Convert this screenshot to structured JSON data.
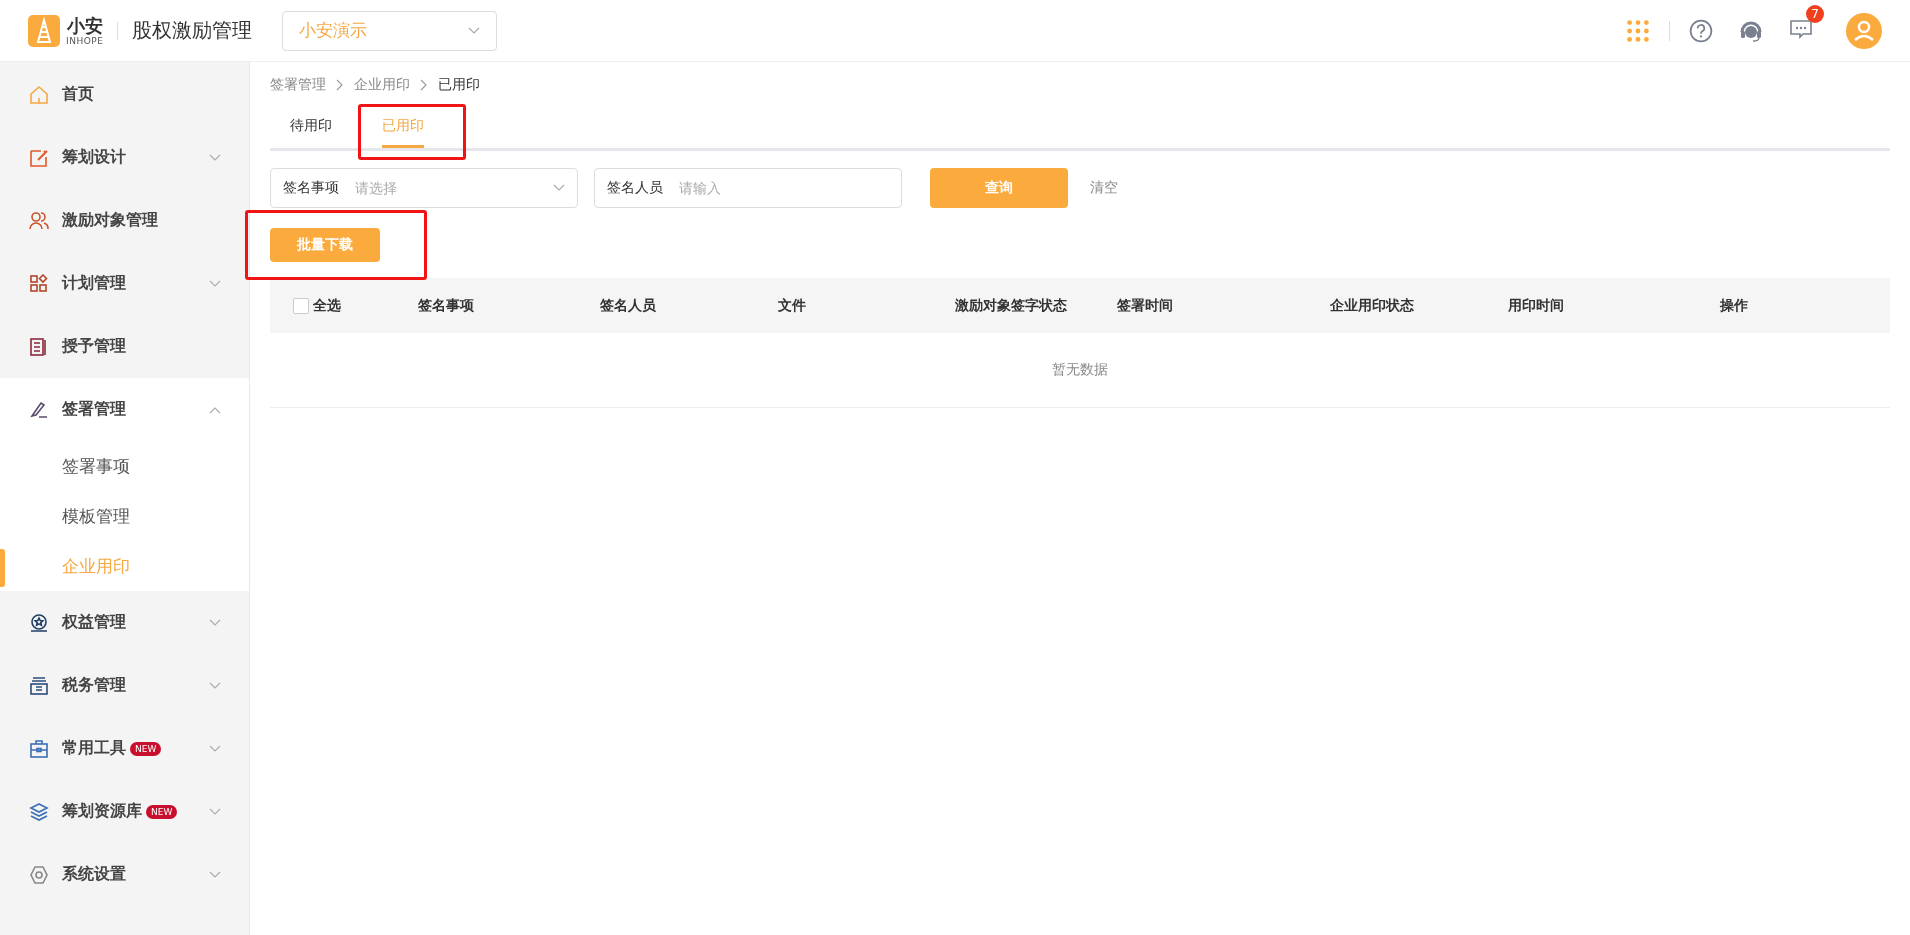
{
  "header": {
    "logo_text": "小安",
    "logo_subtext": "INHOPE",
    "title": "股权激励管理",
    "company_select": {
      "value": "小安演示"
    },
    "message_count": "7"
  },
  "sidebar": {
    "items": [
      {
        "label": "首页",
        "kind": "link",
        "selected": false
      },
      {
        "label": "筹划设计",
        "kind": "group",
        "expanded": false
      },
      {
        "label": "激励对象管理",
        "kind": "link",
        "selected": false
      },
      {
        "label": "计划管理",
        "kind": "group",
        "expanded": false
      },
      {
        "label": "授予管理",
        "kind": "link",
        "selected": false
      },
      {
        "label": "签署管理",
        "kind": "group",
        "expanded": true,
        "children": [
          {
            "label": "签署事项",
            "selected": false
          },
          {
            "label": "模板管理",
            "selected": false
          },
          {
            "label": "企业用印",
            "selected": true
          }
        ]
      },
      {
        "label": "权益管理",
        "kind": "group",
        "expanded": false
      },
      {
        "label": "税务管理",
        "kind": "group",
        "expanded": false
      },
      {
        "label": "常用工具",
        "kind": "group",
        "expanded": false,
        "badge": "NEW"
      },
      {
        "label": "筹划资源库",
        "kind": "group",
        "expanded": false,
        "badge": "NEW"
      },
      {
        "label": "系统设置",
        "kind": "group",
        "expanded": false
      }
    ]
  },
  "breadcrumb": [
    "签署管理",
    "企业用印",
    "已用印"
  ],
  "tabs": [
    {
      "label": "待用印",
      "selected": false
    },
    {
      "label": "已用印",
      "selected": true
    }
  ],
  "filters": [
    {
      "kind": "select",
      "label": "签名事项",
      "placeholder": "请选择"
    },
    {
      "kind": "input",
      "label": "签名人员",
      "placeholder": "请输入"
    }
  ],
  "query_button": "查询",
  "clear_button": "清空",
  "batch_download_button": "批量下载",
  "table": {
    "select_all": {
      "label": "全选",
      "checked": false
    },
    "columns": [
      "签名事项",
      "签名人员",
      "文件",
      "激励对象签字状态",
      "签署时间",
      "企业用印状态",
      "用印时间",
      "操作"
    ],
    "empty_text": "暂无数据"
  }
}
